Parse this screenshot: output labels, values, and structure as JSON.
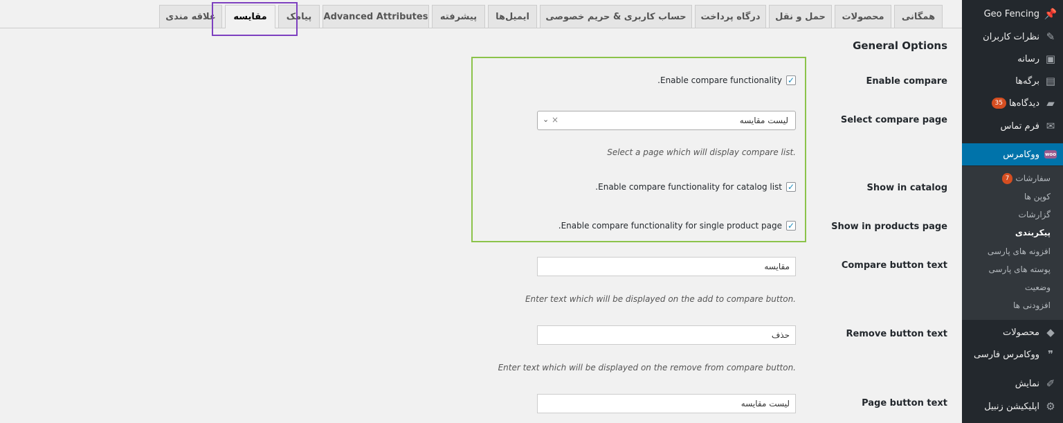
{
  "sidebar": {
    "items": [
      {
        "label": "Geo Fencing",
        "icon": "pin-icon"
      },
      {
        "label": "نظرات کاربران",
        "icon": "edit-icon"
      },
      {
        "label": "رسانه",
        "icon": "media-icon"
      },
      {
        "label": "برگه‌ها",
        "icon": "pages-icon"
      },
      {
        "label": "دیدگاه‌ها",
        "icon": "comments-icon",
        "badge": "35"
      },
      {
        "label": "فرم تماس",
        "icon": "mail-icon"
      },
      {
        "label": "ووکامرس",
        "icon": "woo-icon",
        "icon_text": "woo"
      }
    ],
    "submenu": [
      {
        "label": "سفارشات",
        "badge": "7"
      },
      {
        "label": "کوپن ها"
      },
      {
        "label": "گزارشات"
      },
      {
        "label": "پیکربندی"
      },
      {
        "label": "افزونه های پارسی"
      },
      {
        "label": "پوسته های پارسی"
      },
      {
        "label": "وضعیت"
      },
      {
        "label": "افزودنی ها"
      }
    ],
    "bottom": [
      {
        "label": "محصولات",
        "icon": "box-icon"
      },
      {
        "label": "ووکامرس فارسی",
        "icon": "quote-icon"
      },
      {
        "label": "نمایش",
        "icon": "brush-icon"
      },
      {
        "label": "اپلیکیشن زنبیل",
        "icon": "gear-icon"
      }
    ]
  },
  "tabs": [
    "همگانی",
    "محصولات",
    "حمل و نقل",
    "درگاه پرداخت",
    "حساب کاربری & حریم خصوصی",
    "ایمیل‌ها",
    "پیشرفته",
    "Advanced Attributes",
    "پیامک",
    "مقایسه",
    "علاقه مندی"
  ],
  "active_tab": "مقایسه",
  "section_title": "General Options",
  "fields": {
    "enable_compare": {
      "label": "Enable compare",
      "checkbox_text": "Enable compare functionality.",
      "checked": true
    },
    "compare_page": {
      "label": "Select compare page",
      "value": "لیست مقایسه",
      "clear": "×",
      "arrow": "⌄",
      "description": "Select a page which will display compare list."
    },
    "show_catalog": {
      "label": "Show in catalog",
      "checkbox_text": "Enable compare functionality for catalog list.",
      "checked": true
    },
    "show_products": {
      "label": "Show in products page",
      "checkbox_text": "Enable compare functionality for single product page.",
      "checked": true
    },
    "compare_button": {
      "label": "Compare button text",
      "value": "مقایسه",
      "description": "Enter text which will be displayed on the add to compare button."
    },
    "remove_button": {
      "label": "Remove button text",
      "value": "حذف",
      "description": "Enter text which will be displayed on the remove from compare button."
    },
    "page_button": {
      "label": "Page button text",
      "value": "لیست مقایسه"
    }
  },
  "colors": {
    "sidebar_bg": "#23282d",
    "active_menu": "#0073aa",
    "highlight_purple": "#7d3fbf",
    "highlight_green": "#8bc34a",
    "badge": "#d54e21"
  }
}
